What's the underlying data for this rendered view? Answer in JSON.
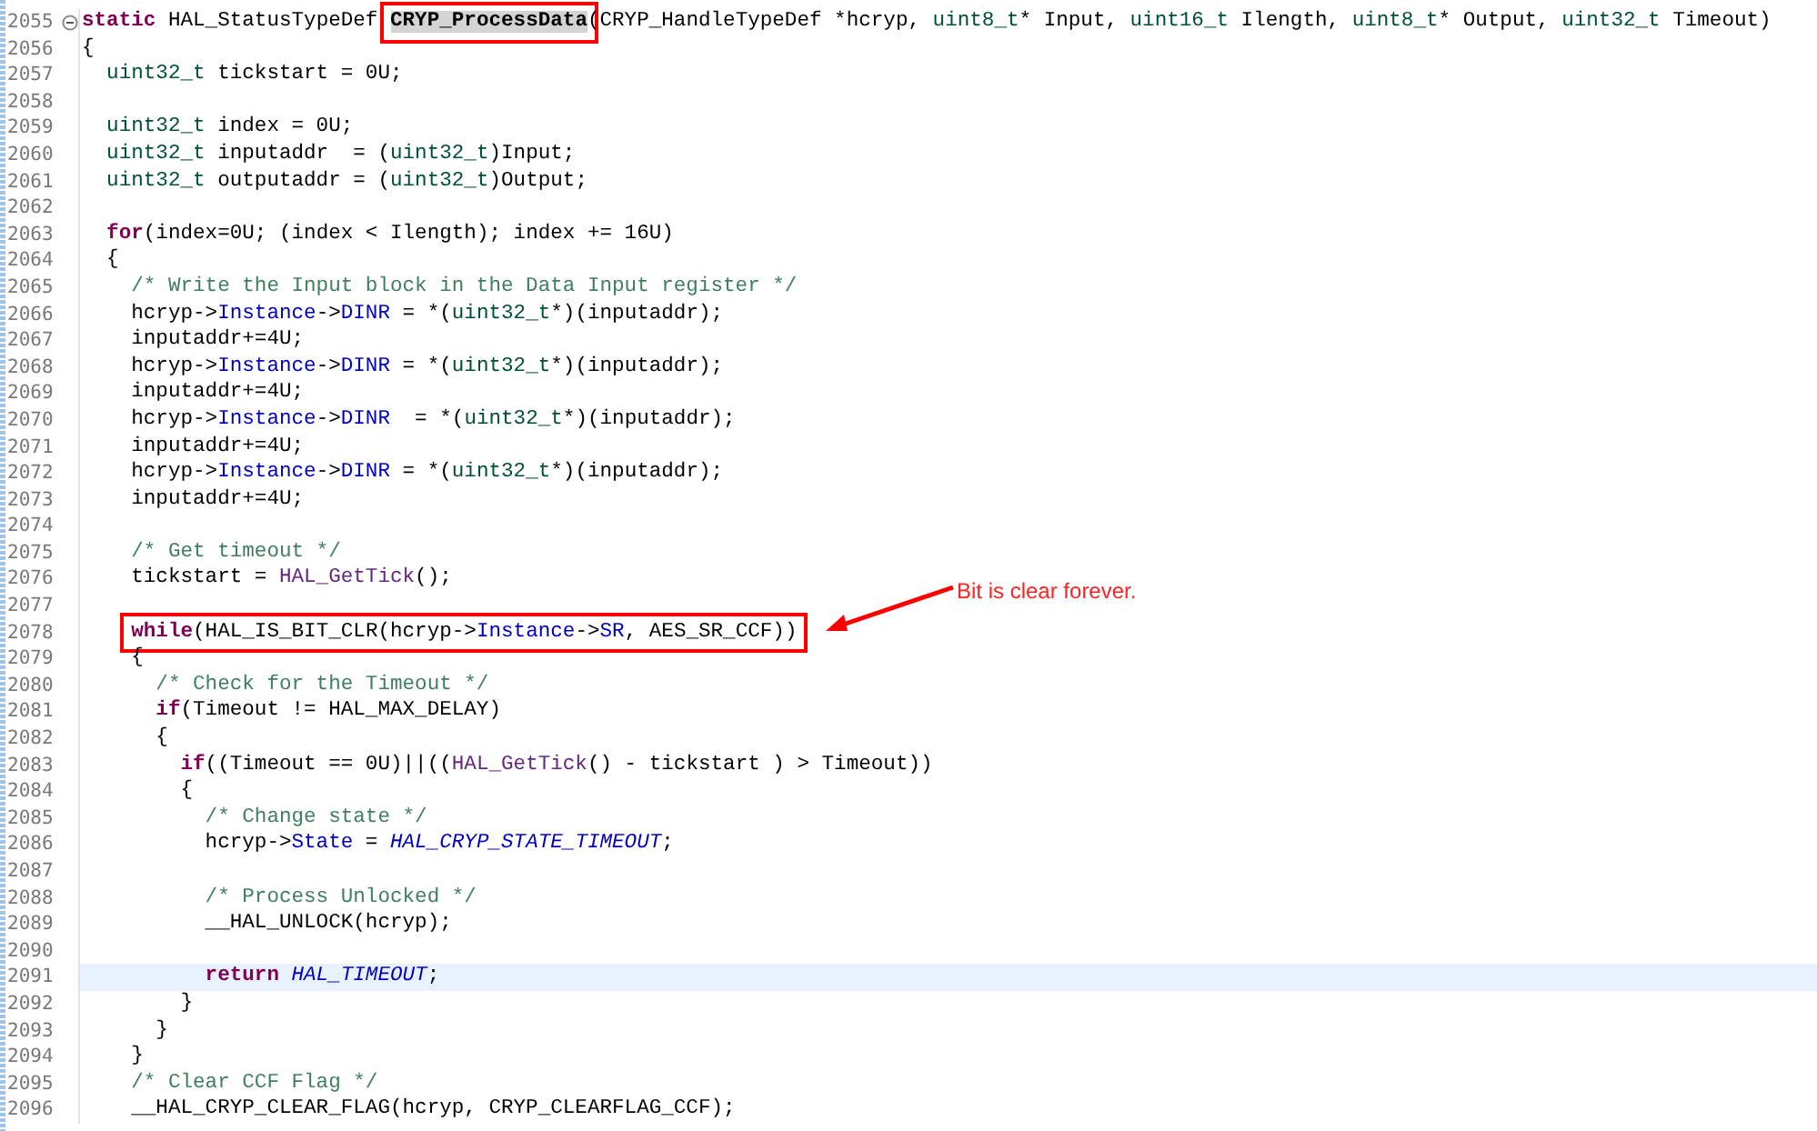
{
  "lines": [
    {
      "number": "2055",
      "foldable": true,
      "current": false,
      "tokens": [
        {
          "kind": "keyword",
          "text": "static"
        },
        {
          "kind": "plain",
          "text": " HAL_StatusTypeDef "
        },
        {
          "kind": "box",
          "tokens": [
            {
              "kind": "occurrence",
              "text": "CRYP_ProcessData"
            }
          ]
        },
        {
          "kind": "plain",
          "text": "(CRYP_HandleTypeDef *hcryp, "
        },
        {
          "kind": "type",
          "text": "uint8_t"
        },
        {
          "kind": "plain",
          "text": "* Input, "
        },
        {
          "kind": "type",
          "text": "uint16_t"
        },
        {
          "kind": "plain",
          "text": " Ilength, "
        },
        {
          "kind": "type",
          "text": "uint8_t"
        },
        {
          "kind": "plain",
          "text": "* Output, "
        },
        {
          "kind": "type",
          "text": "uint32_t"
        },
        {
          "kind": "plain",
          "text": " Timeout)"
        }
      ]
    },
    {
      "number": "2056",
      "foldable": false,
      "current": false,
      "tokens": [
        {
          "kind": "plain",
          "text": "{"
        }
      ]
    },
    {
      "number": "2057",
      "foldable": false,
      "current": false,
      "tokens": [
        {
          "kind": "type",
          "text": "  uint32_t"
        },
        {
          "kind": "plain",
          "text": " tickstart = 0U;"
        }
      ]
    },
    {
      "number": "2058",
      "foldable": false,
      "current": false
    },
    {
      "number": "2059",
      "foldable": false,
      "current": false,
      "tokens": [
        {
          "kind": "type",
          "text": "  uint32_t"
        },
        {
          "kind": "plain",
          "text": " index = 0U;"
        }
      ]
    },
    {
      "number": "2060",
      "foldable": false,
      "current": false,
      "tokens": [
        {
          "kind": "type",
          "text": "  uint32_t"
        },
        {
          "kind": "plain",
          "text": " inputaddr  = ("
        },
        {
          "kind": "type",
          "text": "uint32_t"
        },
        {
          "kind": "plain",
          "text": ")Input;"
        }
      ]
    },
    {
      "number": "2061",
      "foldable": false,
      "current": false,
      "tokens": [
        {
          "kind": "type",
          "text": "  uint32_t"
        },
        {
          "kind": "plain",
          "text": " outputaddr = ("
        },
        {
          "kind": "type",
          "text": "uint32_t"
        },
        {
          "kind": "plain",
          "text": ")Output;"
        }
      ]
    },
    {
      "number": "2062",
      "foldable": false,
      "current": false
    },
    {
      "number": "2063",
      "foldable": false,
      "current": false,
      "tokens": [
        {
          "kind": "keyword",
          "text": "  for"
        },
        {
          "kind": "plain",
          "text": "(index=0U; (index < Ilength); index += 16U)"
        }
      ]
    },
    {
      "number": "2064",
      "foldable": false,
      "current": false,
      "tokens": [
        {
          "kind": "plain",
          "text": "  {"
        }
      ]
    },
    {
      "number": "2065",
      "foldable": false,
      "current": false,
      "tokens": [
        {
          "kind": "comment",
          "text": "    /* Write the Input block in the Data Input register */"
        }
      ]
    },
    {
      "number": "2066",
      "foldable": false,
      "current": false,
      "tokens": [
        {
          "kind": "plain",
          "text": "    hcryp->"
        },
        {
          "kind": "field",
          "text": "Instance"
        },
        {
          "kind": "plain",
          "text": "->"
        },
        {
          "kind": "field",
          "text": "DINR"
        },
        {
          "kind": "plain",
          "text": " = *("
        },
        {
          "kind": "type",
          "text": "uint32_t"
        },
        {
          "kind": "plain",
          "text": "*)(inputaddr);"
        }
      ]
    },
    {
      "number": "2067",
      "foldable": false,
      "current": false,
      "tokens": [
        {
          "kind": "plain",
          "text": "    inputaddr+=4U;"
        }
      ]
    },
    {
      "number": "2068",
      "foldable": false,
      "current": false,
      "tokens": [
        {
          "kind": "plain",
          "text": "    hcryp->"
        },
        {
          "kind": "field",
          "text": "Instance"
        },
        {
          "kind": "plain",
          "text": "->"
        },
        {
          "kind": "field",
          "text": "DINR"
        },
        {
          "kind": "plain",
          "text": " = *("
        },
        {
          "kind": "type",
          "text": "uint32_t"
        },
        {
          "kind": "plain",
          "text": "*)(inputaddr);"
        }
      ]
    },
    {
      "number": "2069",
      "foldable": false,
      "current": false,
      "tokens": [
        {
          "kind": "plain",
          "text": "    inputaddr+=4U;"
        }
      ]
    },
    {
      "number": "2070",
      "foldable": false,
      "current": false,
      "tokens": [
        {
          "kind": "plain",
          "text": "    hcryp->"
        },
        {
          "kind": "field",
          "text": "Instance"
        },
        {
          "kind": "plain",
          "text": "->"
        },
        {
          "kind": "field",
          "text": "DINR"
        },
        {
          "kind": "plain",
          "text": "  = *("
        },
        {
          "kind": "type",
          "text": "uint32_t"
        },
        {
          "kind": "plain",
          "text": "*)(inputaddr);"
        }
      ]
    },
    {
      "number": "2071",
      "foldable": false,
      "current": false,
      "tokens": [
        {
          "kind": "plain",
          "text": "    inputaddr+=4U;"
        }
      ]
    },
    {
      "number": "2072",
      "foldable": false,
      "current": false,
      "tokens": [
        {
          "kind": "plain",
          "text": "    hcryp->"
        },
        {
          "kind": "field",
          "text": "Instance"
        },
        {
          "kind": "plain",
          "text": "->"
        },
        {
          "kind": "field",
          "text": "DINR"
        },
        {
          "kind": "plain",
          "text": " = *("
        },
        {
          "kind": "type",
          "text": "uint32_t"
        },
        {
          "kind": "plain",
          "text": "*)(inputaddr);"
        }
      ]
    },
    {
      "number": "2073",
      "foldable": false,
      "current": false,
      "tokens": [
        {
          "kind": "plain",
          "text": "    inputaddr+=4U;"
        }
      ]
    },
    {
      "number": "2074",
      "foldable": false,
      "current": false
    },
    {
      "number": "2075",
      "foldable": false,
      "current": false,
      "tokens": [
        {
          "kind": "comment",
          "text": "    /* Get timeout */"
        }
      ]
    },
    {
      "number": "2076",
      "foldable": false,
      "current": false,
      "tokens": [
        {
          "kind": "plain",
          "text": "    tickstart = "
        },
        {
          "kind": "macro",
          "text": "HAL_GetTick"
        },
        {
          "kind": "plain",
          "text": "();"
        }
      ]
    },
    {
      "number": "2077",
      "foldable": false,
      "current": false
    },
    {
      "number": "2078",
      "foldable": false,
      "current": false,
      "tokens": [
        {
          "kind": "box",
          "tokens": [
            {
              "kind": "keyword",
              "text": "    while"
            },
            {
              "kind": "plain",
              "text": "(HAL_IS_BIT_CLR(hcryp->"
            },
            {
              "kind": "field",
              "text": "Instance"
            },
            {
              "kind": "plain",
              "text": "->"
            },
            {
              "kind": "field",
              "text": "SR"
            },
            {
              "kind": "plain",
              "text": ", AES_SR_CCF))"
            }
          ]
        }
      ]
    },
    {
      "number": "2079",
      "foldable": false,
      "current": false,
      "tokens": [
        {
          "kind": "plain",
          "text": "    {"
        }
      ]
    },
    {
      "number": "2080",
      "foldable": false,
      "current": false,
      "tokens": [
        {
          "kind": "comment",
          "text": "      /* Check for the Timeout */"
        }
      ]
    },
    {
      "number": "2081",
      "foldable": false,
      "current": false,
      "tokens": [
        {
          "kind": "keyword",
          "text": "      if"
        },
        {
          "kind": "plain",
          "text": "(Timeout != HAL_MAX_DELAY)"
        }
      ]
    },
    {
      "number": "2082",
      "foldable": false,
      "current": false,
      "tokens": [
        {
          "kind": "plain",
          "text": "      {"
        }
      ]
    },
    {
      "number": "2083",
      "foldable": false,
      "current": false,
      "tokens": [
        {
          "kind": "keyword",
          "text": "        if"
        },
        {
          "kind": "plain",
          "text": "((Timeout == 0U)||(("
        },
        {
          "kind": "macro",
          "text": "HAL_GetTick"
        },
        {
          "kind": "plain",
          "text": "() - tickstart ) > Timeout))"
        }
      ]
    },
    {
      "number": "2084",
      "foldable": false,
      "current": false,
      "tokens": [
        {
          "kind": "plain",
          "text": "        {"
        }
      ]
    },
    {
      "number": "2085",
      "foldable": false,
      "current": false,
      "tokens": [
        {
          "kind": "comment",
          "text": "          /* Change state */"
        }
      ]
    },
    {
      "number": "2086",
      "foldable": false,
      "current": false,
      "tokens": [
        {
          "kind": "plain",
          "text": "          hcryp->"
        },
        {
          "kind": "field",
          "text": "State"
        },
        {
          "kind": "plain",
          "text": " = "
        },
        {
          "kind": "enum",
          "text": "HAL_CRYP_STATE_TIMEOUT"
        },
        {
          "kind": "plain",
          "text": ";"
        }
      ]
    },
    {
      "number": "2087",
      "foldable": false,
      "current": false
    },
    {
      "number": "2088",
      "foldable": false,
      "current": false,
      "tokens": [
        {
          "kind": "comment",
          "text": "          /* Process Unlocked */"
        }
      ]
    },
    {
      "number": "2089",
      "foldable": false,
      "current": false,
      "tokens": [
        {
          "kind": "plain",
          "text": "          __HAL_UNLOCK(hcryp);"
        }
      ]
    },
    {
      "number": "2090",
      "foldable": false,
      "current": false
    },
    {
      "number": "2091",
      "foldable": false,
      "current": true,
      "tokens": [
        {
          "kind": "keyword",
          "text": "          return"
        },
        {
          "kind": "enum",
          "text": " HAL_TIMEOUT"
        },
        {
          "kind": "plain",
          "text": ";"
        }
      ]
    },
    {
      "number": "2092",
      "foldable": false,
      "current": false,
      "tokens": [
        {
          "kind": "plain",
          "text": "        }"
        }
      ]
    },
    {
      "number": "2093",
      "foldable": false,
      "current": false,
      "tokens": [
        {
          "kind": "plain",
          "text": "      }"
        }
      ]
    },
    {
      "number": "2094",
      "foldable": false,
      "current": false,
      "tokens": [
        {
          "kind": "plain",
          "text": "    }"
        }
      ]
    },
    {
      "number": "2095",
      "foldable": false,
      "current": false,
      "tokens": [
        {
          "kind": "comment",
          "text": "    /* Clear CCF Flag */"
        }
      ]
    },
    {
      "number": "2096",
      "foldable": false,
      "current": false,
      "tokens": [
        {
          "kind": "plain",
          "text": "    __HAL_CRYP_CLEAR_FLAG(hcryp, CRYP_CLEARFLAG_CCF);"
        }
      ]
    }
  ],
  "annotation": {
    "text": "Bit is clear forever."
  }
}
